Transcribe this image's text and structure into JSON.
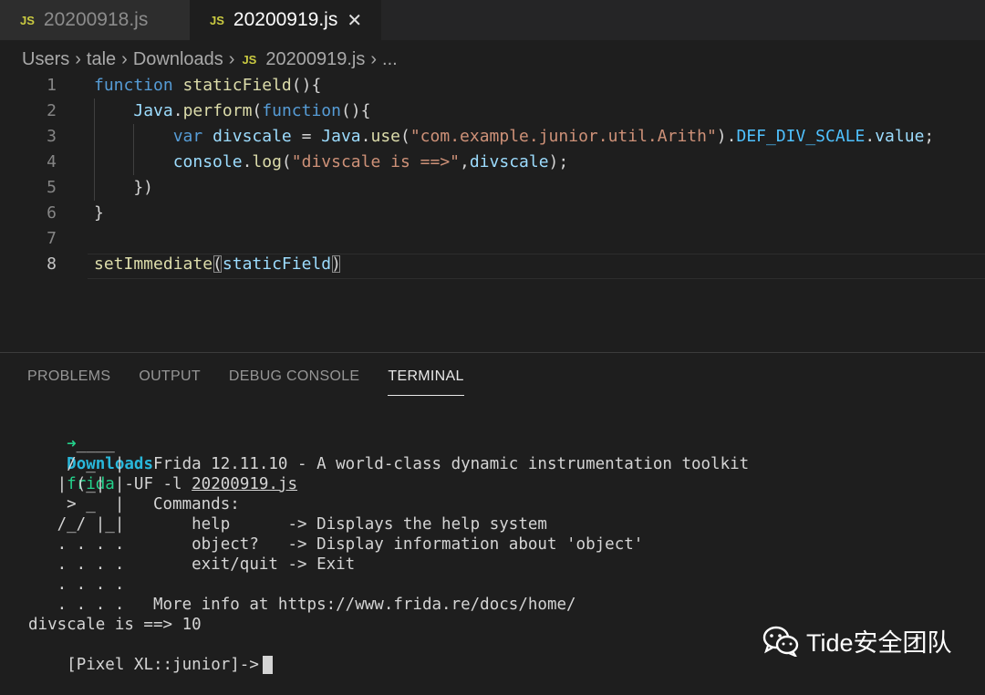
{
  "tabs": [
    {
      "icon": "JS",
      "label": "20200918.js"
    },
    {
      "icon": "JS",
      "label": "20200919.js",
      "close": "✕"
    }
  ],
  "breadcrumb": {
    "items": [
      "Users",
      "tale",
      "Downloads"
    ],
    "file_icon": "JS",
    "file": "20200919.js",
    "more": "...",
    "sep": "›"
  },
  "editor": {
    "line_numbers": [
      "1",
      "2",
      "3",
      "4",
      "5",
      "6",
      "7",
      "8"
    ],
    "active_line": 8,
    "lines": [
      [
        {
          "t": "function",
          "c": "kw"
        },
        {
          "t": " ",
          "c": "pl"
        },
        {
          "t": "staticField",
          "c": "fn"
        },
        {
          "t": "(){",
          "c": "pl"
        }
      ],
      [
        {
          "t": "    ",
          "c": "pl"
        },
        {
          "t": "Java",
          "c": "var"
        },
        {
          "t": ".",
          "c": "pl"
        },
        {
          "t": "perform",
          "c": "fn"
        },
        {
          "t": "(",
          "c": "pl"
        },
        {
          "t": "function",
          "c": "kw"
        },
        {
          "t": "(){",
          "c": "pl"
        }
      ],
      [
        {
          "t": "        ",
          "c": "pl"
        },
        {
          "t": "var",
          "c": "kw"
        },
        {
          "t": " ",
          "c": "pl"
        },
        {
          "t": "divscale",
          "c": "var"
        },
        {
          "t": " = ",
          "c": "pl"
        },
        {
          "t": "Java",
          "c": "var"
        },
        {
          "t": ".",
          "c": "pl"
        },
        {
          "t": "use",
          "c": "fn"
        },
        {
          "t": "(",
          "c": "pl"
        },
        {
          "t": "\"com.example.junior.util.Arith\"",
          "c": "str"
        },
        {
          "t": ").",
          "c": "pl"
        },
        {
          "t": "DEF_DIV_SCALE",
          "c": "const"
        },
        {
          "t": ".",
          "c": "pl"
        },
        {
          "t": "value",
          "c": "var"
        },
        {
          "t": ";",
          "c": "pl"
        }
      ],
      [
        {
          "t": "        ",
          "c": "pl"
        },
        {
          "t": "console",
          "c": "var"
        },
        {
          "t": ".",
          "c": "pl"
        },
        {
          "t": "log",
          "c": "fn"
        },
        {
          "t": "(",
          "c": "pl"
        },
        {
          "t": "\"divscale is ==>\"",
          "c": "str"
        },
        {
          "t": ",",
          "c": "pl"
        },
        {
          "t": "divscale",
          "c": "var"
        },
        {
          "t": ");",
          "c": "pl"
        }
      ],
      [
        {
          "t": "    })",
          "c": "pl"
        }
      ],
      [
        {
          "t": "}",
          "c": "pl"
        }
      ],
      [],
      [
        {
          "t": "setImmediate",
          "c": "fn"
        },
        {
          "t": "(",
          "c": "pl brk"
        },
        {
          "t": "staticField",
          "c": "var"
        },
        {
          "t": ")",
          "c": "pl brk"
        }
      ]
    ]
  },
  "panel": {
    "tabs": [
      "PROBLEMS",
      "OUTPUT",
      "DEBUG CONSOLE",
      "TERMINAL"
    ],
    "active_tab": "TERMINAL"
  },
  "terminal": {
    "prompt_arrow": "➜",
    "prompt_dir": "Downloads",
    "command_name": "frida",
    "command_args": " -UF -l ",
    "command_file": "20200919.js",
    "banner": [
      "     ____",
      "    / _  |   Frida 12.11.10 - A world-class dynamic instrumentation toolkit",
      "   | (_| |",
      "    > _  |   Commands:",
      "   /_/ |_|       help      -> Displays the help system",
      "   . . . .       object?   -> Display information about 'object'",
      "   . . . .       exit/quit -> Exit",
      "   . . . .",
      "   . . . .   More info at https://www.frida.re/docs/home/"
    ],
    "output": "divscale is ==> 10",
    "repl_prompt": "[Pixel XL::junior]->"
  },
  "watermark": {
    "label": "Tide安全团队",
    "icon": "wechat-icon"
  },
  "colors": {
    "background": "#1e1e1e",
    "keyword": "#569cd6",
    "function": "#dcdcaa",
    "variable": "#9cdcfe",
    "string": "#ce9178",
    "constant": "#4fc1ff",
    "prompt_green": "#23d18b",
    "prompt_cyan": "#29b8db",
    "js_icon": "#cbcb41"
  }
}
